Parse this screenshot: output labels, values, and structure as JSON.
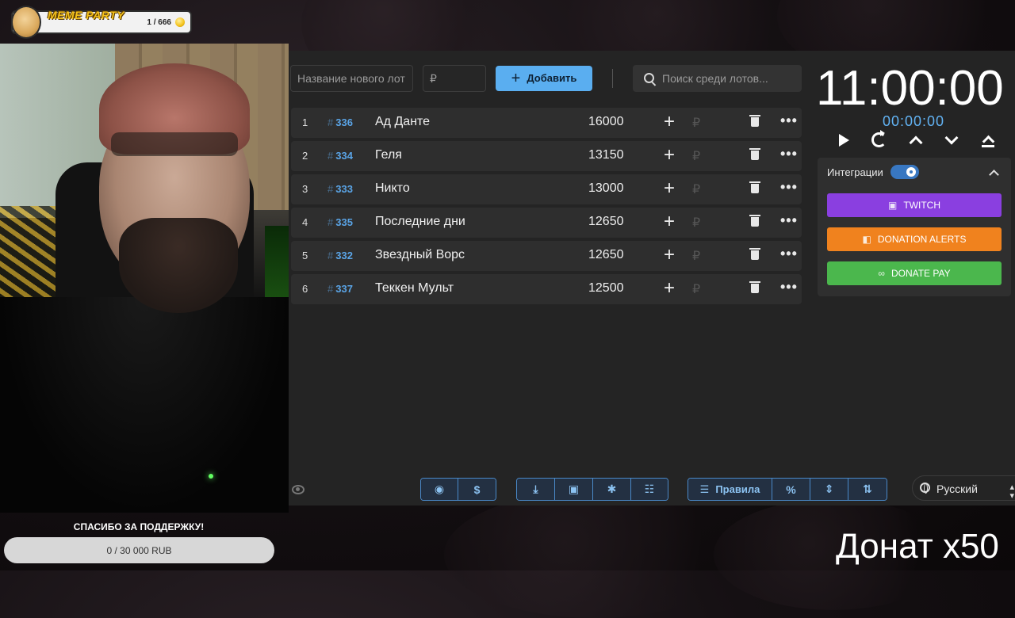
{
  "overlay": {
    "meme_title": "MEME PARTY",
    "meme_count": "1 / 666",
    "thanks_text": "СПАСИБО ЗА ПОДДЕРЖКУ!",
    "progress_text": "0 / 30 000 RUB",
    "progress_fraction": 0,
    "donat_text": "Донат x50"
  },
  "toolbar": {
    "new_lot_placeholder": "Название нового лот",
    "amount_placeholder": "₽",
    "add_label": "Добавить",
    "search_placeholder": "Поиск среди лотов..."
  },
  "lots": [
    {
      "num": "1",
      "id": "336",
      "name": "Ад Данте",
      "amount": "16000"
    },
    {
      "num": "2",
      "id": "334",
      "name": "Геля",
      "amount": "13150"
    },
    {
      "num": "3",
      "id": "333",
      "name": "Никто",
      "amount": "13000"
    },
    {
      "num": "4",
      "id": "335",
      "name": "Последние дни",
      "amount": "12650"
    },
    {
      "num": "5",
      "id": "332",
      "name": "Звездный Ворс",
      "amount": "12650"
    },
    {
      "num": "6",
      "id": "337",
      "name": "Теккен Мульт",
      "amount": "12500"
    }
  ],
  "lot_symbols": {
    "hash": "#",
    "plus": "+",
    "rub": "₽",
    "more": "•••"
  },
  "timer": {
    "main": "11:00:00",
    "sub": "00:00:00"
  },
  "integrations": {
    "label": "Интеграции",
    "enabled": true,
    "services": [
      {
        "name": "TWITCH",
        "color": "#8a3fe0",
        "icon": "twitch-icon"
      },
      {
        "name": "DONATION ALERTS",
        "color": "#f0821e",
        "icon": "donationalerts-icon"
      },
      {
        "name": "DONATE PAY",
        "color": "#4bb74d",
        "icon": "donatepay-icon"
      }
    ]
  },
  "bottom_toolbar": {
    "rules_label": "Правила",
    "percent_label": "%",
    "language": "Русский",
    "icons": [
      "github-icon",
      "dollar-icon",
      "download-icon",
      "save-icon",
      "bug-icon",
      "clear-list-icon",
      "rules-icon",
      "percent-icon",
      "compress-icon",
      "sort-icon"
    ]
  },
  "colors": {
    "accent": "#5aaef0",
    "lot_id": "#5aa4e6",
    "timer_sub": "#62b3f4",
    "app_bg": "#242424"
  }
}
